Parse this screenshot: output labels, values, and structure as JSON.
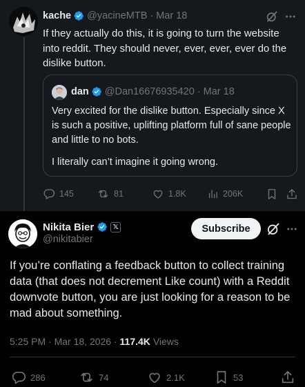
{
  "parent_tweet": {
    "author_name": "kache",
    "handle": "@yacineMTB",
    "separator": "·",
    "date": "Mar 18",
    "text": "If they actually do this, it is going to turn the website into reddit. They should never, ever, ever, ever do the dislike button.",
    "quote": {
      "author_name": "dan",
      "handle": "@Dan16676935420",
      "separator": "·",
      "date": "Mar 18",
      "paragraph_1": "Very excited for the dislike button. Especially since X is such a positive, uplifting platform full of sane people and little to no bots.",
      "paragraph_2": "I literally can’t imagine it going wrong."
    },
    "actions": {
      "replies": "145",
      "reposts": "81",
      "likes": "1.8K",
      "views": "206K"
    }
  },
  "main_tweet": {
    "author_name": "Nikita Bier",
    "affiliation_badge": "𝕏",
    "handle": "@nikitabier",
    "subscribe_label": "Subscribe",
    "text": "If you’re conflating a feedback button to collect training data (that does not decrement Like count) with a Reddit downvote button, you are just looking for a reason to be mad about something.",
    "time": "5:25 PM",
    "date": "Mar 18, 2026",
    "separator_1": "·",
    "separator_2": "·",
    "views_count": "117.4K",
    "views_label": "Views",
    "actions": {
      "replies": "286",
      "reposts": "74",
      "likes": "2.1K",
      "bookmarks": "53"
    }
  },
  "colors": {
    "background": "#000000",
    "parent_background": "#15181c",
    "text_primary": "#e7e9ea",
    "text_secondary": "#71767b",
    "verified_blue": "#1d9bf0",
    "subscribe_bg": "#eff3f4"
  },
  "icons": [
    "verified-badge-icon",
    "grok-icon",
    "more-icon",
    "reply-icon",
    "repost-icon",
    "like-icon",
    "views-icon",
    "bookmark-icon",
    "share-icon"
  ]
}
